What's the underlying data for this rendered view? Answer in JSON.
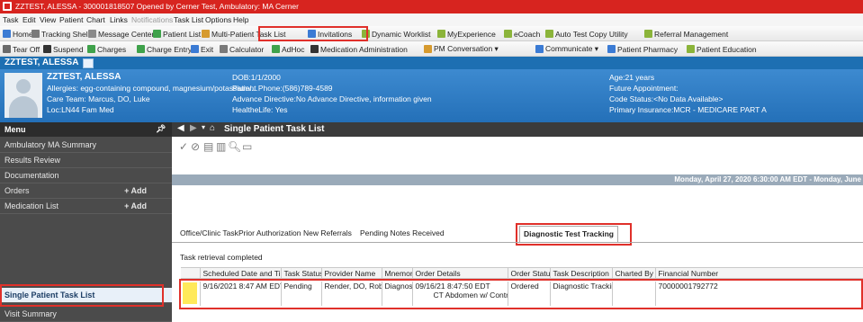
{
  "window": {
    "title": "ZZTEST, ALESSA - 300001818507 Opened by Cerner Test, Ambulatory: MA Cerner"
  },
  "menubar": [
    "Task",
    "Edit",
    "View",
    "Patient",
    "Chart",
    "Links",
    "Notifications",
    "Task List",
    "Options",
    "Help"
  ],
  "toolbar1": [
    {
      "label": "Home",
      "icon": "home-icon",
      "color": "#3b7bd4"
    },
    {
      "label": "Tracking Shell",
      "icon": "tracking-shell-icon",
      "color": "#7a7a7a"
    },
    {
      "label": "Message Center",
      "icon": "message-center-icon",
      "color": "#8a8a8a"
    },
    {
      "label": "Patient List",
      "icon": "patient-list-icon",
      "color": "#3fa24b"
    },
    {
      "label": "Multi-Patient Task List",
      "icon": "task-list-icon",
      "color": "#d69a2e"
    },
    {
      "label": "Invitations",
      "icon": "invitations-icon",
      "color": "#3b7bd4"
    },
    {
      "label": "Dynamic Worklist",
      "icon": "worklist-icon",
      "color": "#8bb43a"
    },
    {
      "label": "MyExperience",
      "icon": "myexperience-icon",
      "color": "#8bb43a"
    },
    {
      "label": "eCoach",
      "icon": "ecoach-icon",
      "color": "#8bb43a"
    },
    {
      "label": "Auto Test Copy Utility",
      "icon": "copy-utility-icon",
      "color": "#8bb43a"
    },
    {
      "label": "Referral Management",
      "icon": "referral-icon",
      "color": "#8bb43a"
    }
  ],
  "toolbar2": [
    {
      "label": "Tear Off",
      "icon": "tear-off-icon",
      "color": "#6a6a6a"
    },
    {
      "label": "Suspend",
      "icon": "suspend-icon",
      "color": "#333"
    },
    {
      "label": "Charges",
      "icon": "charges-icon",
      "color": "#3fa24b"
    },
    {
      "label": "Charge Entry",
      "icon": "charge-entry-icon",
      "color": "#3fa24b"
    },
    {
      "label": "Exit",
      "icon": "exit-icon",
      "color": "#3b7bd4"
    },
    {
      "label": "Calculator",
      "icon": "calculator-icon",
      "color": "#7a7a7a"
    },
    {
      "label": "AdHoc",
      "icon": "adhoc-icon",
      "color": "#3fa24b"
    },
    {
      "label": "Medication Administration",
      "icon": "med-admin-icon",
      "color": "#333"
    },
    {
      "label": "PM Conversation ▾",
      "icon": "pm-conversation-icon",
      "color": "#d69a2e"
    },
    {
      "label": "Communicate ▾",
      "icon": "communicate-icon",
      "color": "#3b7bd4"
    },
    {
      "label": "Patient Pharmacy",
      "icon": "pharmacy-icon",
      "color": "#3b7bd4"
    },
    {
      "label": "Patient Education",
      "icon": "education-icon",
      "color": "#8bb43a"
    }
  ],
  "patient": {
    "tab_name": "ZZTEST, ALESSA",
    "name": "ZZTEST, ALESSA",
    "allergies": "Allergies: egg-containing compound, magnesium/potassium/...",
    "care_team": "Care Team: Marcus, DO, Luke",
    "location": "Loc:LN44 Fam Med",
    "dob": "DOB:1/1/2000",
    "phone": "Patient Phone:(586)789-4589",
    "advance_directive": "Advance Directive:No Advance Directive, information given",
    "healthelife": "HealtheLife: Yes",
    "age": "Age:21 years",
    "future_appt": "Future Appointment:",
    "code_status": "Code Status:<No Data Available>",
    "insurance": "Primary Insurance:MCR - MEDICARE PART A"
  },
  "nav": {
    "header": "Menu",
    "items": [
      {
        "label": "Ambulatory MA Summary",
        "add": ""
      },
      {
        "label": "Results Review",
        "add": ""
      },
      {
        "label": "Documentation",
        "add": ""
      },
      {
        "label": "Orders",
        "add": "+ Add"
      },
      {
        "label": "Medication List",
        "add": "+ Add"
      },
      {
        "label": "",
        "add": ""
      },
      {
        "label": "Single Patient Task List",
        "add": ""
      },
      {
        "label": "Visit Summary",
        "add": ""
      }
    ]
  },
  "content": {
    "title": "Single Patient Task List",
    "date_band": "Monday, April 27, 2020 6:30:00 AM EDT - Monday, June",
    "tabs": [
      "Office/Clinic Task",
      "Prior Authorization",
      "New Referrals",
      "Pending Notes Received",
      "Diagnostic Test Tracking"
    ],
    "status": "Task retrieval completed",
    "columns": [
      "",
      "Scheduled Date and Time",
      "Task Status",
      "Provider Name",
      "Mnemonic",
      "Order Details",
      "Order Status",
      "Task Description",
      "Charted By",
      "Financial Number"
    ],
    "row": {
      "scheduled": "9/16/2021   8:47 AM EDT",
      "status": "Pending",
      "provider": "Render, DO, Robert",
      "mnemonic": "Diagnostic...",
      "details_line1": "09/16/21 8:47:50 EDT",
      "details_line2": "CT Abdomen w/ Contrast",
      "order_status": "Ordered",
      "description": "Diagnostic Tracking",
      "charted_by": "",
      "financial": "70000001792772"
    }
  }
}
